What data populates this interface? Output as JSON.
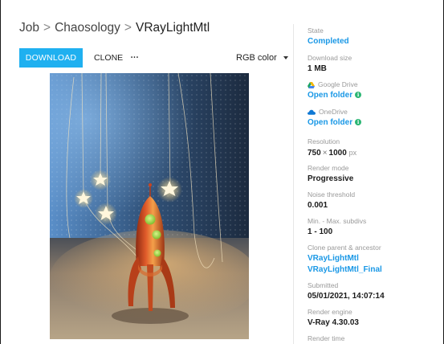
{
  "breadcrumb": {
    "root": "Job",
    "parent": "Chaosology",
    "current": "VRayLightMtl",
    "separator": ">"
  },
  "toolbar": {
    "download_label": "DOWNLOAD",
    "clone_label": "CLONE",
    "more_label": "···",
    "color_mode": "RGB color"
  },
  "colors": {
    "accent": "#1fb0f0",
    "link": "#1a98e6",
    "info_badge": "#2bb673"
  },
  "details": {
    "state": {
      "label": "State",
      "value": "Completed"
    },
    "download_size": {
      "label": "Download size",
      "value": "1 MB"
    },
    "google_drive": {
      "label": "Google Drive",
      "link": "Open folder",
      "icon": "google-drive-icon"
    },
    "onedrive": {
      "label": "OneDrive",
      "link": "Open folder",
      "icon": "onedrive-icon"
    },
    "resolution": {
      "label": "Resolution",
      "width": "750",
      "times": "×",
      "height": "1000",
      "unit": "px"
    },
    "render_mode": {
      "label": "Render mode",
      "value": "Progressive"
    },
    "noise_threshold": {
      "label": "Noise threshold",
      "value": "0.001"
    },
    "subdivs": {
      "label": "Min. - Max. subdivs",
      "value": "1 - 100"
    },
    "clone_parent": {
      "label": "Clone parent & ancestor",
      "parent": "VRayLightMtl",
      "ancestor": "VRayLightMtl_Final"
    },
    "submitted": {
      "label": "Submitted",
      "value": "05/01/2021, 14:07:14"
    },
    "render_engine": {
      "label": "Render engine",
      "value": "V-Ray 4.30.03"
    },
    "render_time": {
      "label": "Render time"
    }
  }
}
